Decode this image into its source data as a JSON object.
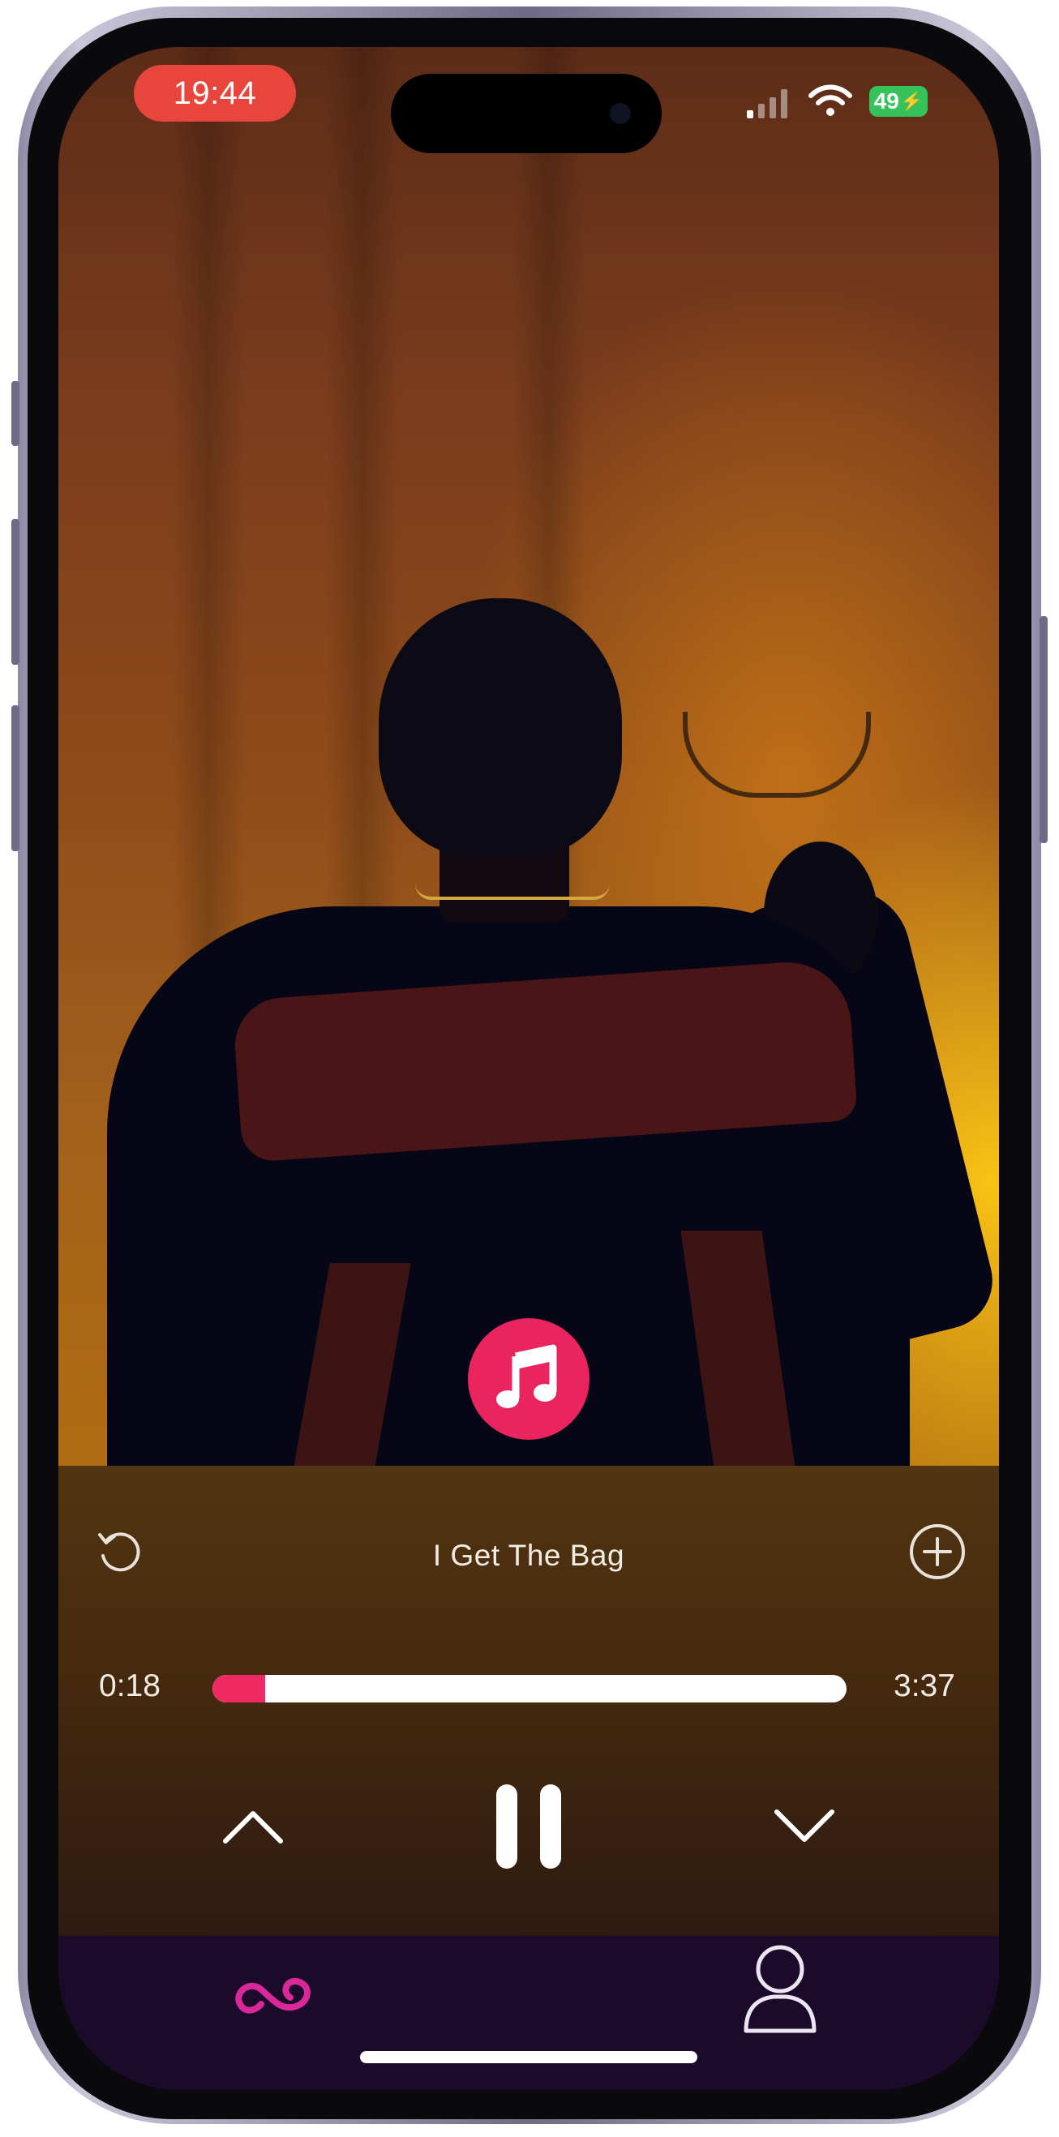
{
  "status_bar": {
    "time": "19:44",
    "battery": "49"
  },
  "player": {
    "song_title": "I Get The Bag",
    "elapsed": "0:18",
    "duration": "3:37",
    "progress_fraction": 0.083
  },
  "icons": {
    "music": "music-note-icon",
    "replay": "replay-icon",
    "add": "plus-circle-icon",
    "previous": "chevron-up-icon",
    "pause": "pause-icon",
    "next": "chevron-down-icon",
    "feed": "infinity-icon",
    "profile": "person-icon"
  },
  "colors": {
    "accent": "#ef2a63",
    "fab": "#e9245f",
    "tabbar": "#1c0a2b",
    "tab_active": "#d8289a",
    "time_pill": "#e8453c",
    "battery": "#36c25a"
  }
}
